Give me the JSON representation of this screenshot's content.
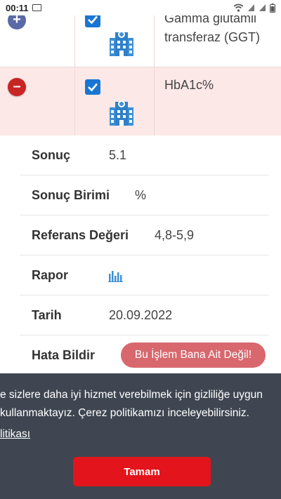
{
  "status_bar": {
    "time": "00:11",
    "icons": [
      "image-icon",
      "wifi-icon",
      "signal-icon",
      "signal-icon",
      "battery-icon"
    ]
  },
  "results_table": {
    "rows": [
      {
        "toggle_symbol": "+",
        "checked": true,
        "icon": "hospital-icon",
        "test_name_line1": "Gamma glutamil",
        "test_name_line2": "transferaz (GGT)"
      },
      {
        "toggle_symbol": "–",
        "checked": true,
        "icon": "hospital-icon",
        "test_name": "HbA1c%",
        "expanded": true
      }
    ]
  },
  "details": {
    "result_label": "Sonuç",
    "result_value": "5.1",
    "unit_label": "Sonuç Birimi",
    "unit_value": "%",
    "reference_label": "Referans Değeri",
    "reference_value": "4,8-5,9",
    "report_label": "Rapor",
    "report_icon": "bar-chart-icon",
    "date_label": "Tarih",
    "date_value": "20.09.2022",
    "error_label": "Hata Bildir",
    "error_button": "Bu İşlem Bana Ait Değil!"
  },
  "cookie_banner": {
    "line1": "e sizlere daha iyi hizmet verebilmek için gizliliğe uygun",
    "line2": "kullanmaktayız. Çerez politikamızı inceleyebilirsiniz.",
    "link": "litikası",
    "ok_button": "Tamam"
  },
  "colors": {
    "expanded_row_bg": "#fde8e8",
    "minus_toggle": "#c82525",
    "plus_toggle": "#5a6aa6",
    "checkbox": "#1976d2",
    "hospital_icon": "#3d8fd6",
    "error_button": "#d8686e",
    "cookie_bg": "#3f4651",
    "ok_button": "#e3141b"
  }
}
